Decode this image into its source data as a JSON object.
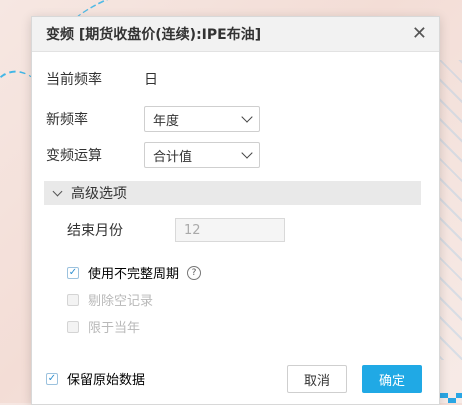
{
  "dialog": {
    "title": "变频 [期货收盘价(连续):IPE布油]",
    "current_frequency_label": "当前频率",
    "current_frequency_value": "日",
    "new_frequency_label": "新频率",
    "new_frequency_value": "年度",
    "operation_label": "变频运算",
    "operation_value": "合计值",
    "advanced_label": "高级选项",
    "end_month_label": "结束月份",
    "end_month_value": "12",
    "use_incomplete_label": "使用不完整周期",
    "remove_empty_label": "剔除空记录",
    "limit_current_year_label": "限于当年",
    "keep_original_label": "保留原始数据",
    "cancel_label": "取消",
    "ok_label": "确定"
  },
  "colors": {
    "accent": "#20a9e5",
    "dialog_bg": "#ffffff",
    "titlebar_bg": "#f2f2f2"
  },
  "checkboxes": {
    "use_incomplete": true,
    "remove_empty": false,
    "limit_current_year": false,
    "keep_original": true
  }
}
